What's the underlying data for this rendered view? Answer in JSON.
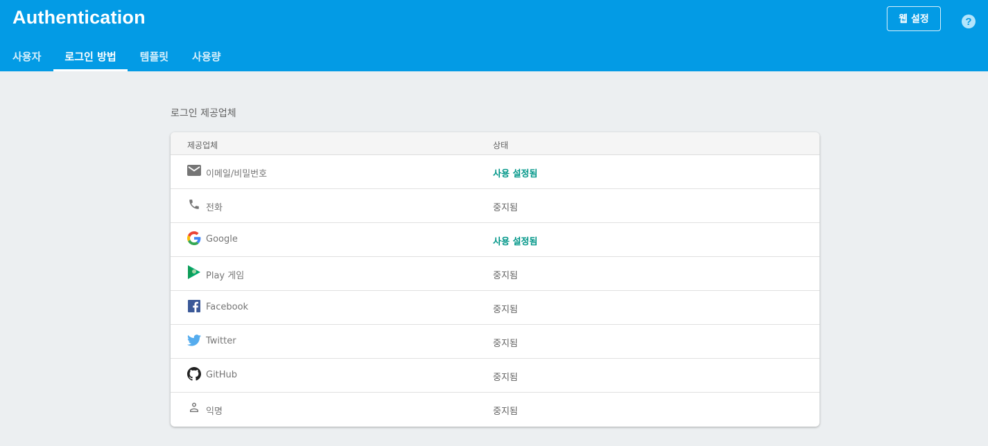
{
  "header": {
    "title": "Authentication",
    "web_setup_label": "웹 설정",
    "help_label": "?"
  },
  "tabs": [
    {
      "label": "사용자",
      "active": false
    },
    {
      "label": "로그인 방법",
      "active": true
    },
    {
      "label": "템플릿",
      "active": false
    },
    {
      "label": "사용량",
      "active": false
    }
  ],
  "section": {
    "title": "로그인 제공업체"
  },
  "table": {
    "columns": [
      "제공업체",
      "상태"
    ],
    "rows": [
      {
        "icon": "email-icon",
        "provider": "이메일/비밀번호",
        "status": "사용 설정됨",
        "enabled": true
      },
      {
        "icon": "phone-icon",
        "provider": "전화",
        "status": "중지됨",
        "enabled": false
      },
      {
        "icon": "google-icon",
        "provider": "Google",
        "status": "사용 설정됨",
        "enabled": true
      },
      {
        "icon": "play-games-icon",
        "provider": "Play 게임",
        "status": "중지됨",
        "enabled": false
      },
      {
        "icon": "facebook-icon",
        "provider": "Facebook",
        "status": "중지됨",
        "enabled": false
      },
      {
        "icon": "twitter-icon",
        "provider": "Twitter",
        "status": "중지됨",
        "enabled": false
      },
      {
        "icon": "github-icon",
        "provider": "GitHub",
        "status": "중지됨",
        "enabled": false
      },
      {
        "icon": "anonymous-person-icon",
        "provider": "익명",
        "status": "중지됨",
        "enabled": false
      }
    ]
  },
  "colors": {
    "header_bg": "#039be5",
    "page_bg": "#eceff1",
    "enabled_status": "#009688"
  }
}
